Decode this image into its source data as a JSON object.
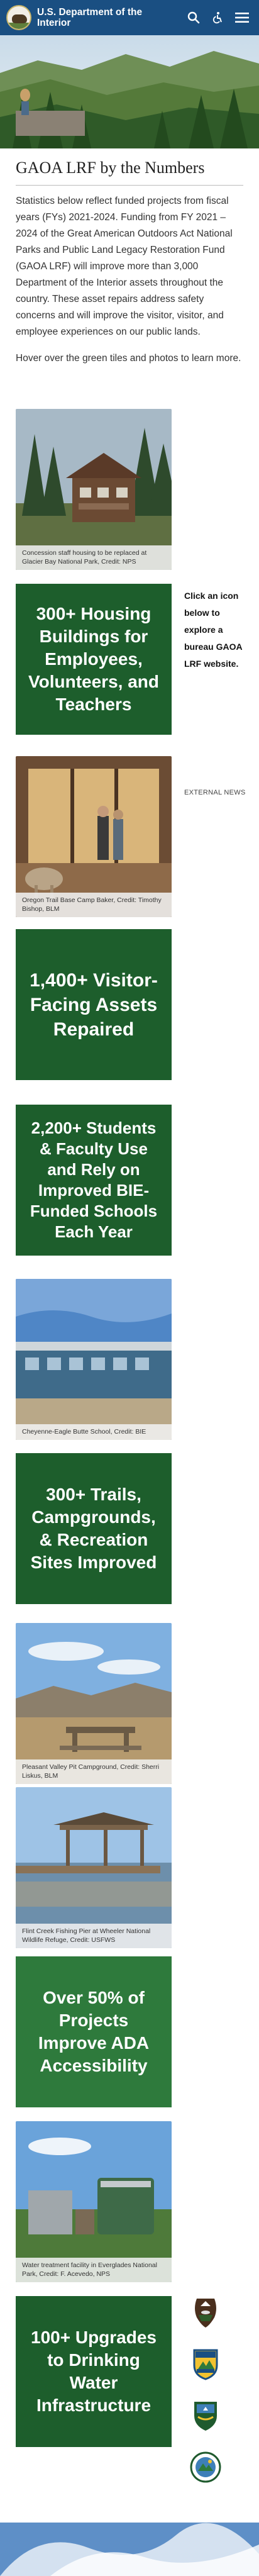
{
  "header": {
    "title": "U.S. Department of the Interior",
    "logo_icon": "doi-bison-seal-icon",
    "search_icon": "search-icon",
    "accessibility_icon": "accessibility-icon",
    "menu_icon": "hamburger-menu-icon",
    "bg_color": "#1a4f82"
  },
  "hero": {
    "image": "forest-hillside-photo"
  },
  "intro": {
    "title": "GAOA LRF by the Numbers",
    "paragraph1": "Statistics below reflect funded projects from fiscal years (FYs) 2021-2024. Funding from FY 2021 –2024 of the Great American Outdoors Act National Parks and Public Land Legacy Restoration Fund (GAOA LRF) will improve more than 3,000 Department of the Interior assets throughout the country.  These asset repairs address safety concerns and will improve the visitor, visitor, and employee experiences on our public lands.",
    "paragraph2": "Hover over the green tiles and photos to learn more."
  },
  "items": [
    {
      "type": "photo",
      "caption": "Concession staff housing to be replaced at Glacier Bay National Park, Credit: NPS"
    },
    {
      "type": "tile",
      "text": "300+ Housing Buildings for Employees, Volunteers, and Teachers"
    },
    {
      "type": "photo",
      "caption": "Oregon Trail Base Camp Baker, Credit: Timothy Bishop, BLM"
    },
    {
      "type": "tile",
      "text": "1,400+ Visitor-Facing Assets Repaired"
    },
    {
      "type": "tile",
      "text": "2,200+ Students & Faculty Use and Rely on Improved BIE-Funded Schools Each Year"
    },
    {
      "type": "photo",
      "caption": "Cheyenne-Eagle Butte School, Credit: BIE"
    },
    {
      "type": "tile",
      "text": "300+ Trails, Campgrounds, & Recreation Sites Improved"
    },
    {
      "type": "photo",
      "caption": "Pleasant Valley Pit Campground, Credit: Sherri Liskus, BLM"
    },
    {
      "type": "photo",
      "caption": "Flint Creek Fishing Pier at Wheeler National Wildlife Refuge, Credit: USFWS"
    },
    {
      "type": "tile",
      "text": "Over 50% of Projects Improve ADA Accessibility"
    },
    {
      "type": "photo",
      "caption": "Water treatment facility in Everglades National Park, Credit: F. Acevedo, NPS"
    },
    {
      "type": "tile",
      "text": "100+ Upgrades to Drinking Water Infrastructure"
    }
  ],
  "side_note": "Click an icon below to explore a bureau GAOA LRF website.",
  "external_news": "EXTERNAL NEWS",
  "bureau_badges": [
    {
      "icon": "nps-arrowhead-icon"
    },
    {
      "icon": "blm-badge-icon"
    },
    {
      "icon": "usfws-shield-icon"
    },
    {
      "icon": "bie-seal-icon"
    }
  ],
  "colors": {
    "tile_green": "#1d5e2c",
    "tile_green_light": "#2e7a3c"
  }
}
